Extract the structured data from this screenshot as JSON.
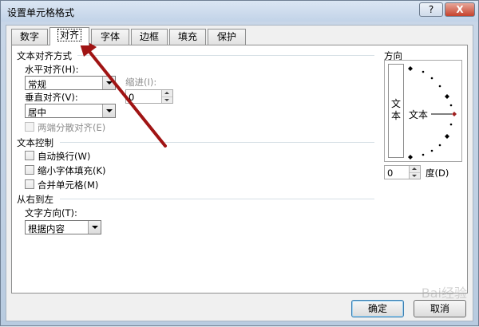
{
  "window": {
    "title": "设置单元格格式",
    "help_label": "?",
    "close_label": "X"
  },
  "tabs": [
    {
      "label": "数字"
    },
    {
      "label": "对齐"
    },
    {
      "label": "字体"
    },
    {
      "label": "边框"
    },
    {
      "label": "填充"
    },
    {
      "label": "保护"
    }
  ],
  "active_tab": 1,
  "text_alignment": {
    "section_title": "文本对齐方式",
    "horizontal_label": "水平对齐(H):",
    "horizontal_value": "常规",
    "indent_label": "缩进(I):",
    "indent_value": "0",
    "vertical_label": "垂直对齐(V):",
    "vertical_value": "居中",
    "justify_distributed_label": "两端分散对齐(E)"
  },
  "text_control": {
    "section_title": "文本控制",
    "wrap_text": "自动换行(W)",
    "shrink_to_fit": "缩小字体填充(K)",
    "merge_cells": "合并单元格(M)"
  },
  "rtl": {
    "section_title": "从右到左",
    "direction_label": "文字方向(T):",
    "direction_value": "根据内容"
  },
  "orientation": {
    "section_title": "方向",
    "vertical_text": "文本",
    "sample_text": "文本",
    "degrees_value": "0",
    "degrees_label": "度(D)"
  },
  "buttons": {
    "ok": "确定",
    "cancel": "取消"
  },
  "watermark": "Bai经验",
  "colors": {
    "annotation_arrow": "#a01414",
    "orientation_marker": "#a02020"
  }
}
